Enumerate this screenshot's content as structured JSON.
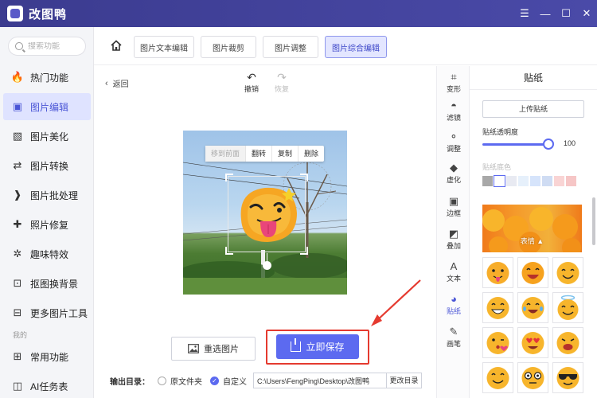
{
  "window": {
    "title": "改图鸭",
    "controls": [
      "☰",
      "—",
      "☐",
      "✕"
    ]
  },
  "sidebar": {
    "search_placeholder": "搜索功能",
    "items": [
      {
        "label": "热门功能",
        "icon": "fire-icon",
        "glyph": "🔥",
        "active": false
      },
      {
        "label": "图片编辑",
        "icon": "image-edit-icon",
        "glyph": "▣",
        "active": true
      },
      {
        "label": "图片美化",
        "icon": "image-beautify-icon",
        "glyph": "▧",
        "active": false
      },
      {
        "label": "图片转换",
        "icon": "image-convert-icon",
        "glyph": "⇄",
        "active": false
      },
      {
        "label": "图片批处理",
        "icon": "batch-icon",
        "glyph": "❱",
        "active": false
      },
      {
        "label": "照片修复",
        "icon": "photo-repair-icon",
        "glyph": "✚",
        "active": false
      },
      {
        "label": "趣味特效",
        "icon": "fun-effects-icon",
        "glyph": "✲",
        "active": false
      },
      {
        "label": "抠图换背景",
        "icon": "cutout-icon",
        "glyph": "⊡",
        "active": false
      },
      {
        "label": "更多图片工具",
        "icon": "more-tools-icon",
        "glyph": "⊟",
        "active": false
      }
    ],
    "section_label": "我的",
    "bottom_items": [
      {
        "label": "常用功能",
        "icon": "common-functions-icon",
        "glyph": "⊞"
      },
      {
        "label": "AI任务表",
        "icon": "ai-task-icon",
        "glyph": "◫"
      }
    ]
  },
  "toolbar": {
    "tabs": [
      {
        "label": "图片文本编辑",
        "active": false
      },
      {
        "label": "图片裁剪",
        "active": false
      },
      {
        "label": "图片调整",
        "active": false
      },
      {
        "label": "图片综合编辑",
        "active": true
      }
    ]
  },
  "editor": {
    "back_label": "返回",
    "undo_label": "撤销",
    "redo_label": "恢复",
    "context_menu": [
      "移到前面",
      "翻转",
      "复制",
      "删除"
    ],
    "reselect_label": "重选图片",
    "save_label": "立即保存",
    "output_label": "输出目录：",
    "option_original": "原文件夹",
    "option_custom": "自定义",
    "output_path": "C:\\Users\\FengPing\\Desktop\\改图鸭",
    "change_dir_label": "更改目录"
  },
  "tools": [
    {
      "label": "变形",
      "icon": "transform-icon",
      "glyph": "⌗",
      "active": false
    },
    {
      "label": "滤镜",
      "icon": "filter-icon",
      "glyph": "◓",
      "active": false
    },
    {
      "label": "调整",
      "icon": "adjust-icon",
      "glyph": "⚬",
      "active": false
    },
    {
      "label": "虚化",
      "icon": "blur-icon",
      "glyph": "◆",
      "active": false
    },
    {
      "label": "边框",
      "icon": "border-icon",
      "glyph": "▣",
      "active": false
    },
    {
      "label": "叠加",
      "icon": "overlay-icon",
      "glyph": "◩",
      "active": false
    },
    {
      "label": "文本",
      "icon": "text-icon",
      "glyph": "A",
      "active": false
    },
    {
      "label": "贴纸",
      "icon": "sticker-icon",
      "glyph": "◕",
      "active": true
    },
    {
      "label": "画笔",
      "icon": "brush-icon",
      "glyph": "✎",
      "active": false
    }
  ],
  "sticker_panel": {
    "title": "贴纸",
    "upload_label": "上传贴纸",
    "opacity_label": "贴纸透明度",
    "opacity_value": "100",
    "bg_color_label": "贴纸底色",
    "swatch_colors": [
      "#a8a8a8",
      "#ffffff",
      "#e8eaf2",
      "#e6f0fb",
      "#d6e4fb",
      "#cfdcf3",
      "#f9d4d4",
      "#f6c6c6"
    ],
    "category_label": "表情 ▲",
    "colors": {
      "accent": "#5c6af0",
      "highlight": "#e53a2f"
    }
  }
}
